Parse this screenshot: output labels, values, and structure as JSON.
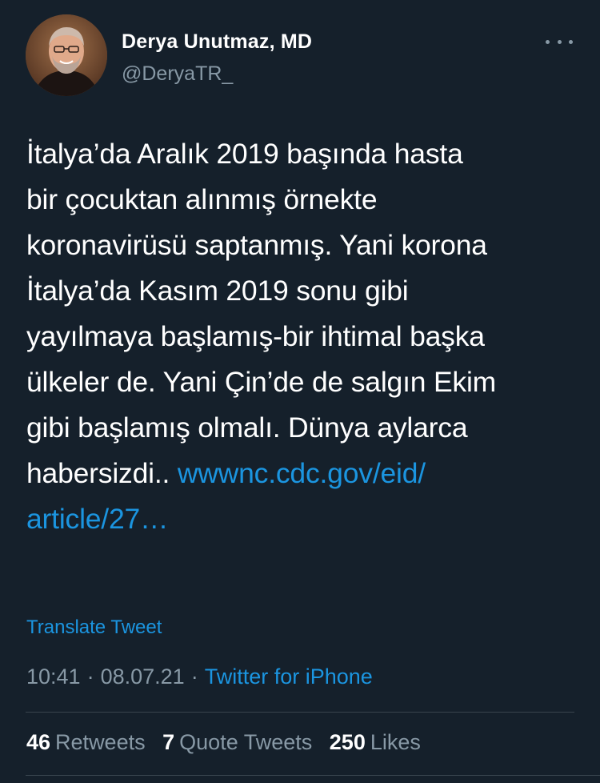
{
  "author": {
    "name": "Derya Unutmaz, MD",
    "handle": "@DeryaTR_",
    "avatar_icon": "profile-photo"
  },
  "more_icon": "ellipsis-icon",
  "tweet": {
    "lines": [
      "İtalya’da Aralık 2019 başında hasta",
      "bir çocuktan alınmış örnekte",
      "koronavirüsü saptanmış. Yani korona",
      "İtalya’da Kasım 2019 sonu gibi",
      "yayılmaya başlamış-bir ihtimal başka",
      "ülkeler de. Yani Çin’de de salgın Ekim",
      "gibi başlamış olmalı. Dünya aylarca",
      "habersizdi.. "
    ],
    "link_part1": "wwwnc.cdc.gov/eid/",
    "link_part2": "article/27…"
  },
  "translate_label": "Translate Tweet",
  "meta": {
    "time": "10:41",
    "separator": "·",
    "date": "08.07.21",
    "source": "Twitter for iPhone"
  },
  "stats": {
    "retweets_count": "46",
    "retweets_label": "Retweets",
    "quotes_count": "7",
    "quotes_label": "Quote Tweets",
    "likes_count": "250",
    "likes_label": "Likes"
  },
  "colors": {
    "background": "#15202b",
    "text": "#ffffff",
    "secondary": "#8899a6",
    "link": "#1b95e0",
    "divider": "#38444d"
  }
}
